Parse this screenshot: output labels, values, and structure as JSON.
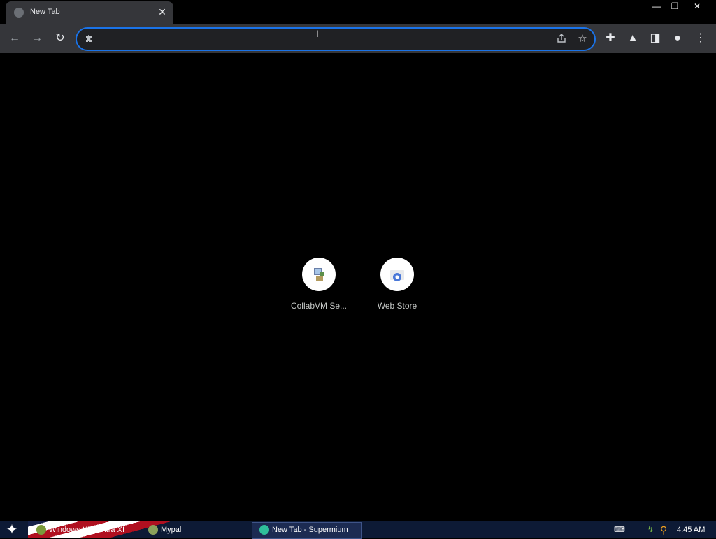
{
  "tab": {
    "title": "New Tab",
    "close_glyph": "✕",
    "favicon": "globe-icon"
  },
  "window_controls": {
    "minimize": "—",
    "restore": "❐",
    "close": "✕"
  },
  "toolbar": {
    "back": "←",
    "forward": "→",
    "reload": "↻",
    "extensions": "✚",
    "labs": "▲",
    "sidepanel": "◨",
    "profile": "●",
    "menu": "⋮"
  },
  "omnibox": {
    "value": "",
    "placeholder": ""
  },
  "shortcuts": [
    {
      "label": "CollabVM Se...",
      "icon": "collabvm-icon"
    },
    {
      "label": "Web Store",
      "icon": "web-store-icon"
    }
  ],
  "taskbar": {
    "start_glyph": "✦",
    "items": [
      {
        "label": "Windows XP / Ultra XI"
      },
      {
        "label": "Mypal"
      },
      {
        "label": "New Tab - Supermium"
      }
    ],
    "clock": "4:45 AM"
  },
  "colors": {
    "accent": "#1a73e8",
    "toolbar": "#35363a",
    "page_bg": "#000000",
    "taskbar": "#0d1a35"
  }
}
